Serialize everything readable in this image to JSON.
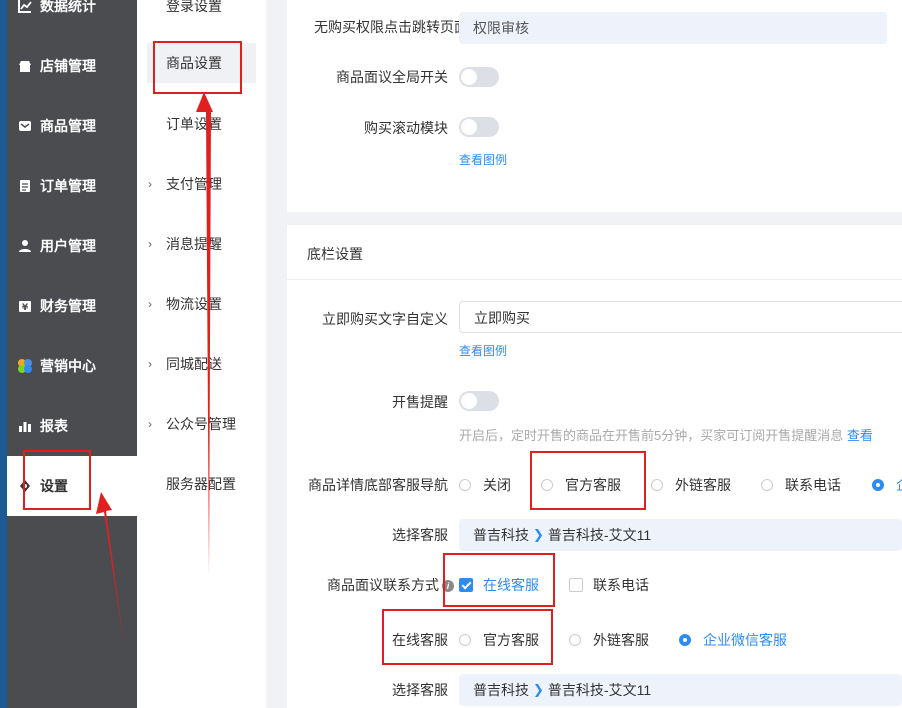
{
  "sidebar": {
    "items": [
      {
        "label": "数据统计",
        "icon": "chart-icon"
      },
      {
        "label": "店铺管理",
        "icon": "store-icon"
      },
      {
        "label": "商品管理",
        "icon": "goods-icon"
      },
      {
        "label": "订单管理",
        "icon": "order-icon"
      },
      {
        "label": "用户管理",
        "icon": "user-icon"
      },
      {
        "label": "财务管理",
        "icon": "finance-icon"
      },
      {
        "label": "营销中心",
        "icon": "marketing-icon"
      },
      {
        "label": "报表",
        "icon": "report-icon"
      },
      {
        "label": "设置",
        "icon": "settings-icon"
      }
    ],
    "active": "设置"
  },
  "submenu": {
    "items": [
      {
        "label": "登录设置",
        "expandable": false
      },
      {
        "label": "商品设置",
        "expandable": false
      },
      {
        "label": "订单设置",
        "expandable": false
      },
      {
        "label": "支付管理",
        "expandable": true
      },
      {
        "label": "消息提醒",
        "expandable": true
      },
      {
        "label": "物流设置",
        "expandable": true
      },
      {
        "label": "同城配送",
        "expandable": true
      },
      {
        "label": "公众号管理",
        "expandable": true
      },
      {
        "label": "服务器配置",
        "expandable": false
      }
    ],
    "active": "商品设置"
  },
  "top_card": {
    "no_permission_label": "无购买权限点击跳转页面",
    "no_permission_value": "权限审核",
    "negotiation_switch_label": "商品面议全局开关",
    "scroll_module_label": "购买滚动模块",
    "view_example": "查看图例"
  },
  "bottom_bar": {
    "section_title": "底栏设置",
    "buy_text_label": "立即购买文字自定义",
    "buy_text_value": "立即购买",
    "view_example": "查看图例",
    "presale_label": "开售提醒",
    "presale_hint": "开启后，定时开售的商品在开售前5分钟，买家可订阅开售提醒消息",
    "presale_hint_link": "查看",
    "service_nav_label": "商品详情底部客服导航",
    "service_nav_options": [
      "关闭",
      "官方客服",
      "外链客服",
      "联系电话",
      "企"
    ],
    "service_nav_selected": 4,
    "choose_service_label": "选择客服",
    "service_path": [
      "普吉科技",
      "普吉科技-艾文11"
    ],
    "contact_method_label": "商品面议联系方式",
    "contact_options": [
      {
        "label": "在线客服",
        "checked": true
      },
      {
        "label": "联系电话",
        "checked": false
      }
    ],
    "online_service_label": "在线客服",
    "online_service_options": [
      "官方客服",
      "外链客服",
      "企业微信客服"
    ],
    "online_service_selected": 2,
    "choose_service_label2": "选择客服",
    "service_path2": [
      "普吉科技",
      "普吉科技-艾文11"
    ]
  },
  "colors": {
    "accent": "#2d8cf0",
    "annotation": "#e02020",
    "sidebar_bg": "#4a4c50"
  }
}
